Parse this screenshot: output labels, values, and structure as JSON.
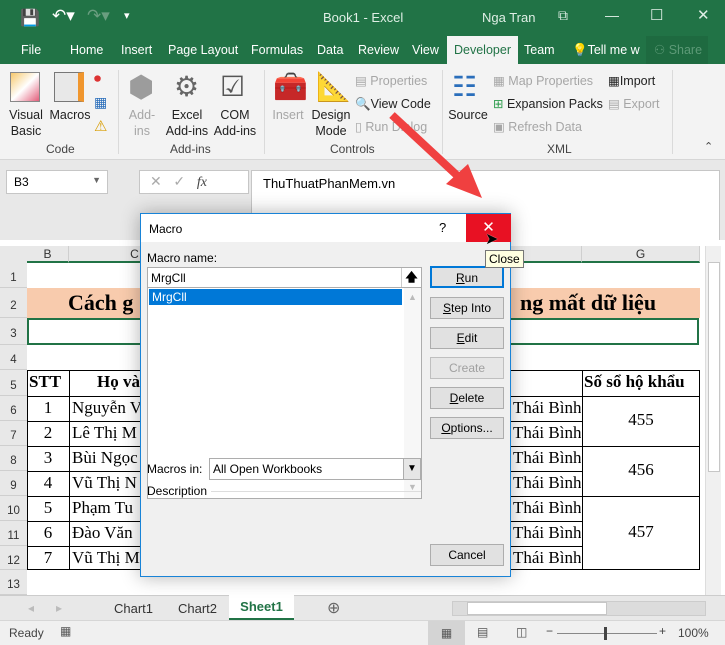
{
  "window": {
    "title": "Book1  -  Excel",
    "user": "Nga Tran"
  },
  "tabs": [
    "File",
    "Home",
    "Insert",
    "Page Layout",
    "Formulas",
    "Data",
    "Review",
    "View",
    "Developer",
    "Team",
    "Tell me w",
    "Share"
  ],
  "ribbon": {
    "code": {
      "label": "Code",
      "visual_basic": [
        "Visual",
        "Basic"
      ],
      "macros": "Macros"
    },
    "addins": {
      "label": "Add-ins",
      "addins": [
        "Add-",
        "ins"
      ],
      "excel_addins": [
        "Excel",
        "Add-ins"
      ],
      "com_addins": [
        "COM",
        "Add-ins"
      ]
    },
    "controls": {
      "label": "Controls",
      "insert": "Insert",
      "design_mode": [
        "Design",
        "Mode"
      ],
      "properties": "Properties",
      "view_code": "View Code",
      "run_dialog": "Run Dialog"
    },
    "xml": {
      "label": "XML",
      "source": "Source",
      "map_properties": "Map Properties",
      "expansion_packs": "Expansion Packs",
      "refresh_data": "Refresh Data",
      "import": "Import",
      "export": "Export"
    }
  },
  "formula_bar": {
    "name_box": "B3",
    "fx": "fx",
    "value": "ThuThuatPhanMem.vn"
  },
  "columns": [
    "B",
    "C",
    "G"
  ],
  "rows": [
    "1",
    "2",
    "3",
    "4",
    "5",
    "6",
    "7",
    "8",
    "9",
    "10",
    "11",
    "12",
    "13"
  ],
  "sheet": {
    "title_left": "Cách g",
    "title_right": "ng mất dữ liệu",
    "headers": {
      "stt": "STT",
      "name": "Họ và",
      "book": "Số sổ hộ khẩu"
    },
    "records": [
      {
        "stt": "1",
        "name": "Nguyễn V",
        "addr": "Thái Bình"
      },
      {
        "stt": "2",
        "name": "Lê Thị M",
        "addr": "Thái Bình"
      },
      {
        "stt": "3",
        "name": "Bùi Ngọc",
        "addr": "Thái Bình"
      },
      {
        "stt": "4",
        "name": "Vũ Thị N",
        "addr": "Thái Bình"
      },
      {
        "stt": "5",
        "name": "Phạm Tu",
        "addr": "Thái Bình"
      },
      {
        "stt": "6",
        "name": "Đào Văn",
        "addr": "Thái Bình"
      },
      {
        "stt": "7",
        "name": "Vũ Thị M",
        "addr": "Thái Bình"
      }
    ],
    "book_numbers": [
      "455",
      "456",
      "457"
    ]
  },
  "sheet_tabs": [
    "Chart1",
    "Chart2",
    "Sheet1"
  ],
  "active_sheet": "Sheet1",
  "status": {
    "ready": "Ready",
    "zoom": "100%"
  },
  "dialog": {
    "title": "Macro",
    "help": "?",
    "tooltip": "Close",
    "macro_name_label": "Macro name:",
    "macro_name_value": "MrgCll",
    "macros": [
      "MrgCll"
    ],
    "buttons": {
      "run": "Run",
      "step_into": "Step Into",
      "edit": "Edit",
      "create": "Create",
      "delete": "Delete",
      "options": "Options...",
      "cancel": "Cancel"
    },
    "macros_in_label": "Macros in:",
    "macros_in_value": "All Open Workbooks",
    "description_label": "Description"
  },
  "colors": {
    "excel_green": "#217346",
    "close_red": "#e81123",
    "selection_blue": "#0078d7",
    "title_fill": "#f8cbad",
    "arrow": "#f04040"
  }
}
